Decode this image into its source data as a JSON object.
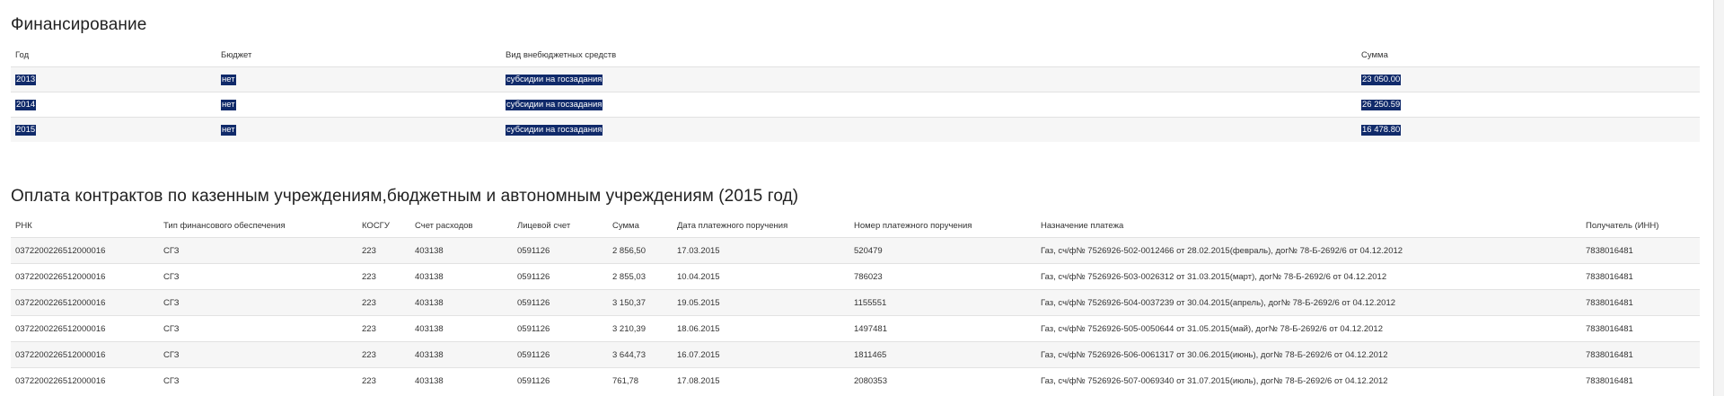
{
  "financing": {
    "title": "Финансирование",
    "columns": [
      "Год",
      "Бюджет",
      "Вид внебюджетных средств",
      "Сумма"
    ],
    "rows": [
      [
        "2013",
        "нет",
        "субсидии на госзадания",
        "23 050.00"
      ],
      [
        "2014",
        "нет",
        "субсидии на госзадания",
        "26 250.59"
      ],
      [
        "2015",
        "нет",
        "субсидии на госзадания",
        "16 478.80"
      ]
    ]
  },
  "payments": {
    "title": "Оплата контрактов по казенным учреждениям,бюджетным и автономным учреждениям (2015 год)",
    "columns": [
      "РНК",
      "Тип финансового обеспечения",
      "КОСГУ",
      "Счет расходов",
      "Лицевой счет",
      "Сумма",
      "Дата платежного поручения",
      "Номер платежного поручения",
      "Назначение платежа",
      "Получатель (ИНН)"
    ],
    "rows": [
      [
        "0372200226512000016",
        "СГЗ",
        "223",
        "403138",
        "0591126",
        "2 856,50",
        "17.03.2015",
        "520479",
        "Газ, сч/ф№ 7526926-502-0012466 от 28.02.2015(февраль), дог№ 78-Б-2692/6 от 04.12.2012",
        "7838016481"
      ],
      [
        "0372200226512000016",
        "СГЗ",
        "223",
        "403138",
        "0591126",
        "2 855,03",
        "10.04.2015",
        "786023",
        "Газ, сч/ф№ 7526926-503-0026312 от 31.03.2015(март), дог№ 78-Б-2692/6 от 04.12.2012",
        "7838016481"
      ],
      [
        "0372200226512000016",
        "СГЗ",
        "223",
        "403138",
        "0591126",
        "3 150,37",
        "19.05.2015",
        "1155551",
        "Газ, сч/ф№ 7526926-504-0037239 от 30.04.2015(апрель), дог№ 78-Б-2692/6 от 04.12.2012",
        "7838016481"
      ],
      [
        "0372200226512000016",
        "СГЗ",
        "223",
        "403138",
        "0591126",
        "3 210,39",
        "18.06.2015",
        "1497481",
        "Газ, сч/ф№ 7526926-505-0050644 от 31.05.2015(май), дог№ 78-Б-2692/6 от 04.12.2012",
        "7838016481"
      ],
      [
        "0372200226512000016",
        "СГЗ",
        "223",
        "403138",
        "0591126",
        "3 644,73",
        "16.07.2015",
        "1811465",
        "Газ, сч/ф№ 7526926-506-0061317 от 30.06.2015(июнь), дог№ 78-Б-2692/6 от 04.12.2012",
        "7838016481"
      ],
      [
        "0372200226512000016",
        "СГЗ",
        "223",
        "403138",
        "0591126",
        "761,78",
        "17.08.2015",
        "2080353",
        "Газ, сч/ф№ 7526926-507-0069340 от 31.07.2015(июль), дог№ 78-Б-2692/6 от 04.12.2012",
        "7838016481"
      ]
    ]
  },
  "colors": {
    "selection": "#102a6a",
    "row_stripe": "#f6f6f6",
    "row_border": "#e2e2e2"
  }
}
